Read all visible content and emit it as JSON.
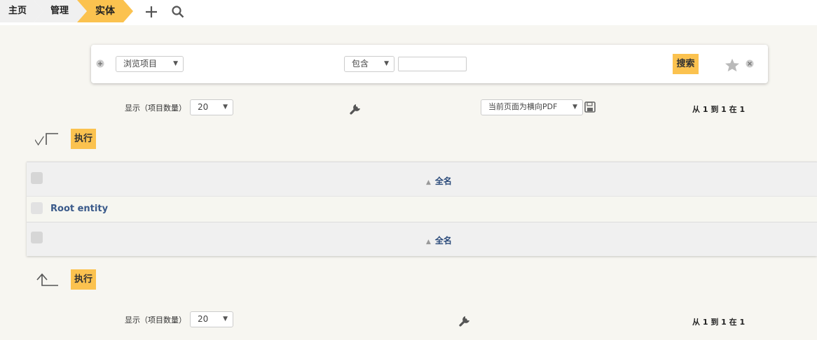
{
  "breadcrumb": {
    "home": "主页",
    "admin": "管理",
    "current": "实体"
  },
  "icons": {
    "add": "plus-icon",
    "search": "search-icon",
    "wrench": "wrench-icon",
    "save": "floppy-icon",
    "star": "star-icon",
    "close": "close-circle-icon",
    "add_criteria": "plus-circle-icon"
  },
  "search": {
    "field_select": "浏览项目",
    "operator_select": "包含",
    "value": "",
    "search_button": "搜索"
  },
  "toolbar_top": {
    "show_label": "显示（项目数量）",
    "page_size": "20",
    "export_select": "当前页面为横向PDF",
    "pagination": "从 1 到 1 在 1"
  },
  "actions": {
    "execute_top": "执行",
    "execute_bottom": "执行"
  },
  "table": {
    "header_col": "全名",
    "footer_col": "全名",
    "rows": [
      {
        "name": "Root entity"
      }
    ]
  },
  "toolbar_bottom": {
    "show_label": "显示（项目数量）",
    "page_size": "20",
    "pagination": "从 1 到 1 在 1"
  },
  "colors": {
    "accent": "#fbc24f",
    "link": "#3a5a8a",
    "background": "#f7f6f1"
  }
}
